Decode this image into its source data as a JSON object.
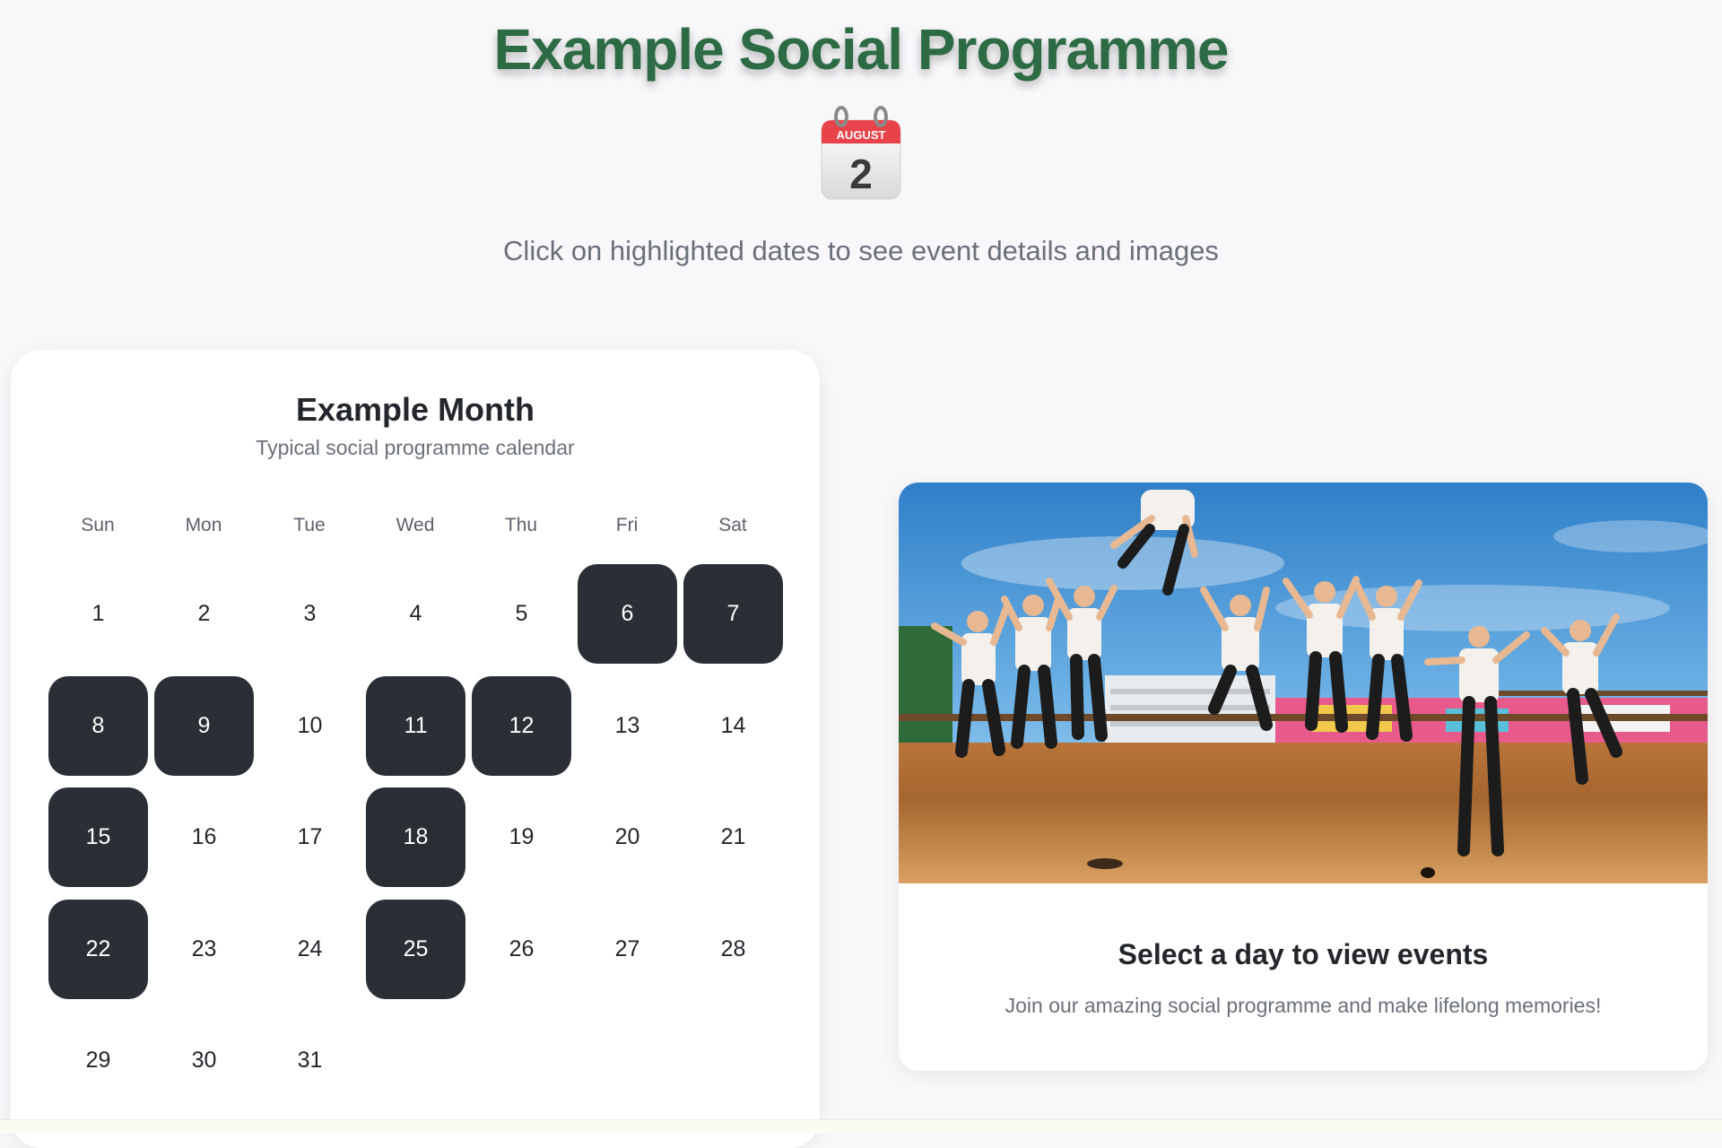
{
  "header": {
    "title": "Example Social Programme",
    "icon": "calendar-icon",
    "icon_month": "AUGUST",
    "icon_day": "2",
    "subtitle": "Click on highlighted dates to see event details and images"
  },
  "calendar": {
    "title": "Example Month",
    "subtitle": "Typical social programme calendar",
    "weekdays": [
      "Sun",
      "Mon",
      "Tue",
      "Wed",
      "Thu",
      "Fri",
      "Sat"
    ],
    "days": [
      "1",
      "2",
      "3",
      "4",
      "5",
      "6",
      "7",
      "8",
      "9",
      "10",
      "11",
      "12",
      "13",
      "14",
      "15",
      "16",
      "17",
      "18",
      "19",
      "20",
      "21",
      "22",
      "23",
      "24",
      "25",
      "26",
      "27",
      "28",
      "29",
      "30",
      "31"
    ],
    "event_days": [
      "6",
      "7",
      "8",
      "9",
      "11",
      "12",
      "15",
      "18",
      "22",
      "25"
    ],
    "highlight_color": "#2a2f36"
  },
  "panel": {
    "image": "group-jumping-photo",
    "title": "Select a day to view events",
    "subtitle": "Join our amazing social programme and make lifelong memories!"
  },
  "colors": {
    "title": "#2d6b45",
    "background": "#f8f8fb"
  }
}
